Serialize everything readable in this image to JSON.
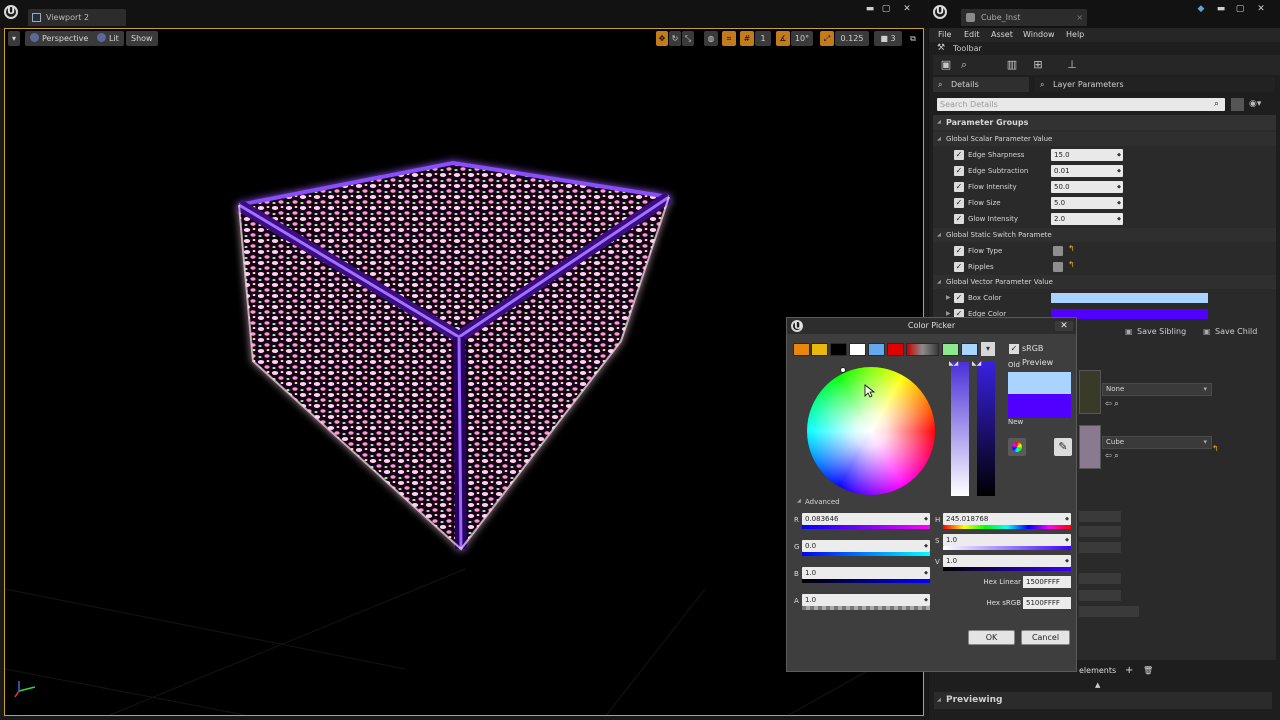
{
  "viewport": {
    "tab_title": "Viewport 2",
    "buttons": {
      "perspective": "Perspective",
      "lit": "Lit",
      "show": "Show"
    },
    "snap": {
      "grid": "1",
      "rotation": "10°",
      "scale": "0.125",
      "camera_speed": "3"
    }
  },
  "editor": {
    "tab_title": "Cube_Inst",
    "menu": [
      "File",
      "Edit",
      "Asset",
      "Window",
      "Help"
    ],
    "toolbar_label": "Toolbar",
    "tabs": {
      "details": "Details",
      "layer_params": "Layer Parameters"
    },
    "search_placeholder": "Search Details",
    "parameter_groups": "Parameter Groups",
    "scalar_group": "Global Scalar Parameter Value",
    "scalar_params": [
      {
        "label": "Edge Sharpness",
        "value": "15.0"
      },
      {
        "label": "Edge Subtraction",
        "value": "0.01"
      },
      {
        "label": "Flow Intensity",
        "value": "50.0"
      },
      {
        "label": "Flow Size",
        "value": "5.0"
      },
      {
        "label": "Glow Intensity",
        "value": "2.0"
      }
    ],
    "switch_group": "Global Static Switch Paramete",
    "switch_params": [
      {
        "label": "Flow Type"
      },
      {
        "label": "Ripples"
      }
    ],
    "vector_group": "Global Vector Parameter Value",
    "vector_params": [
      {
        "label": "Box Color",
        "color": "#a8d4ff"
      },
      {
        "label": "Edge Color",
        "color": "#5100ff"
      }
    ],
    "save_sibling": "Save Sibling",
    "save_child": "Save Child",
    "dropdowns": {
      "none": "None",
      "cube": "Cube"
    },
    "elements_label": "elements",
    "previewing": "Previewing"
  },
  "color_picker": {
    "title": "Color Picker",
    "swatches": [
      "#e8860e",
      "#e8b80e",
      "#000000",
      "#ffffff",
      "#64a8ef",
      "#e00000",
      "#c80000",
      "#8c8c8c",
      "#3a3a3a",
      "#8ee88e",
      "#a8d4ff"
    ],
    "srgb_preview": "sRGB Preview",
    "old_label": "Old",
    "new_label": "New",
    "old_color": "#a8d4ff",
    "new_color": "#5100ff",
    "advanced": "Advanced",
    "channels": {
      "r_label": "R",
      "r": "0.083646",
      "g_label": "G",
      "g": "0.0",
      "b_label": "B",
      "b": "1.0",
      "a_label": "A",
      "a": "1.0",
      "h_label": "H",
      "h": "245.018768",
      "s_label": "S",
      "s": "1.0",
      "v_label": "V",
      "v": "1.0"
    },
    "hex_linear_label": "Hex Linear",
    "hex_linear": "1500FFFF",
    "hex_srgb_label": "Hex sRGB",
    "hex_srgb": "5100FFFF",
    "ok": "OK",
    "cancel": "Cancel"
  }
}
